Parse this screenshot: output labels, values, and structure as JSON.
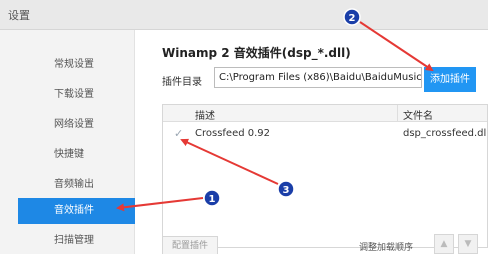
{
  "window": {
    "title": "设置"
  },
  "sidebar": {
    "items": [
      {
        "label": "常规设置",
        "active": false
      },
      {
        "label": "下载设置",
        "active": false
      },
      {
        "label": "网络设置",
        "active": false
      },
      {
        "label": "快捷键",
        "active": false
      },
      {
        "label": "音频输出",
        "active": false
      },
      {
        "label": "音效插件",
        "active": true
      },
      {
        "label": "扫描管理",
        "active": false
      }
    ]
  },
  "main": {
    "heading": "Winamp 2 音效插件(dsp_*.dll)",
    "plugin_dir": {
      "label": "插件目录",
      "value": "C:\\Program Files (x86)\\Baidu\\BaiduMusic"
    },
    "add_button": "添加插件",
    "table": {
      "headers": {
        "description": "描述",
        "filename": "文件名"
      },
      "rows": [
        {
          "checked": true,
          "description": "Crossfeed 0.92",
          "filename": "dsp_crossfeed.dll"
        }
      ]
    },
    "footer": {
      "config_button": "配置插件",
      "order_label": "调整加载顺序"
    }
  },
  "annotations": {
    "color": "#e53935",
    "marker_fill": "#1a3ea8",
    "markers": [
      {
        "number": "1"
      },
      {
        "number": "2"
      },
      {
        "number": "3"
      }
    ]
  }
}
